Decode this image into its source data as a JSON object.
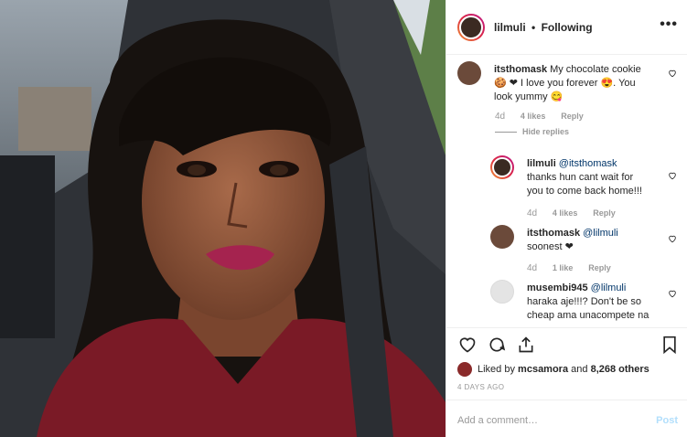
{
  "post": {
    "username": "lilmuli",
    "separator": "•",
    "follow_status": "Following"
  },
  "comments": [
    {
      "user": "itsthomask",
      "text": "My chocolate cookie 🍪 ❤ I love you forever 😍. You look yummy 😋",
      "age": "4d",
      "likes": "4 likes",
      "reply": "Reply"
    },
    {
      "user": "lilmuli",
      "mention": "@itsthomask",
      "text": "thanks hun cant wait for you to come back home!!!",
      "age": "4d",
      "likes": "4 likes",
      "reply": "Reply"
    },
    {
      "user": "itsthomask",
      "mention": "@lilmuli",
      "text": "soonest ❤",
      "age": "4d",
      "likes": "1 like",
      "reply": "Reply"
    },
    {
      "user": "musembi945",
      "mention": "@lilmuli",
      "text": "haraka aje!!!? Don't be so cheap ama unacompete na",
      "age": "",
      "likes": "",
      "reply": ""
    }
  ],
  "hide_replies": "Hide replies",
  "liked_by": {
    "prefix": "Liked by",
    "user": "mcsamora",
    "and": "and",
    "others": "8,268 others"
  },
  "date": "4 DAYS AGO",
  "composer": {
    "placeholder": "Add a comment…",
    "post_label": "Post"
  },
  "icons": [
    "more-icon",
    "heart-icon",
    "comment-icon",
    "share-icon",
    "bookmark-icon"
  ],
  "colors": {
    "link": "#003569",
    "muted": "#999999",
    "post_disabled": "#b2dffc",
    "border": "#efefef"
  }
}
